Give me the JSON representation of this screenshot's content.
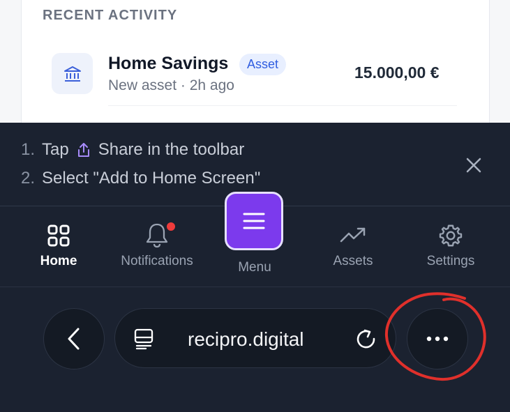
{
  "recent_activity": {
    "title": "RECENT ACTIVITY",
    "items": [
      {
        "icon": "bank-icon",
        "title": "Home Savings",
        "badge": "Asset",
        "subtitle": "New asset · 2h ago",
        "amount": "15.000,00 €"
      }
    ]
  },
  "install_hint": {
    "steps": [
      {
        "num": "1.",
        "text_before": "Tap",
        "icon": "share-icon",
        "text_after": "Share in the toolbar"
      },
      {
        "num": "2.",
        "text": "Select \"Add to Home Screen\""
      }
    ],
    "close_icon": "close-icon"
  },
  "bottom_nav": {
    "items": [
      {
        "label": "Home",
        "icon": "grid-icon",
        "active": true
      },
      {
        "label": "Notifications",
        "icon": "bell-icon",
        "has_badge": true
      },
      {
        "label": "Menu",
        "icon": "hamburger-icon",
        "highlighted": true
      },
      {
        "label": "Assets",
        "icon": "trending-up-icon"
      },
      {
        "label": "Settings",
        "icon": "gear-icon"
      }
    ]
  },
  "browser_bar": {
    "url": "recipro.digital",
    "back_icon": "chevron-left-icon",
    "reader_icon": "reader-icon",
    "reload_icon": "reload-icon",
    "more_icon": "more-dots-icon"
  },
  "colors": {
    "accent": "#7c3aed",
    "dark_bg": "#1b2230",
    "badge_bg": "#e8efff",
    "badge_text": "#2f5de0",
    "notification_dot": "#ef3b3b",
    "annotation": "#e0302b"
  }
}
